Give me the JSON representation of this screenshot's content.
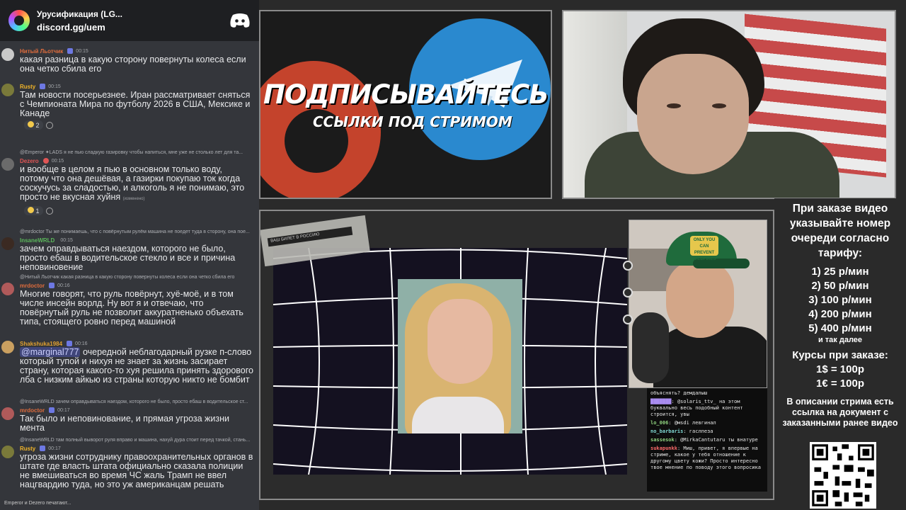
{
  "discord": {
    "server_name": "Урусификация (LG...",
    "invite": "discord.gg/uem",
    "messages": [
      {
        "reply": "",
        "author": "Нитый Льотчик",
        "author_color": "#e06c3c",
        "time": "00:15",
        "text": "какая разница в  какую сторону повернуты колеса если она четко сбила его",
        "mention": "",
        "edited": ""
      },
      {
        "reply": "",
        "author": "Rusty",
        "author_color": "#f0b429",
        "time": "00:15",
        "text": "Там новости посерьезнее. Иран рассматривает сняться с Чемпионата Мира по футболу 2026 в США, Мексике и Канаде",
        "mention": "",
        "edited": "",
        "reaction_count": "2"
      },
      {
        "reply": "@Emperor ✦LADS я не пью сладкую газировку чтобы напиться, мне уже не столько лет для та...",
        "author": "Dezero",
        "author_color": "#e05555",
        "time": "00:15",
        "text": "и вообще в целом я пью в основном только воду, потому что она дешёвая, а газирки покупаю ток когда соскучусь за сладостью, и алкоголь я не понимаю, это просто не вкусная хуйня",
        "mention": "",
        "edited": "(изменено)",
        "reaction_count": "1"
      },
      {
        "reply": "@mrdoctor Ты же понимаешь, что с повёрнутым рулём машина не поедет туда в сторону, она пое...",
        "author": "InsaneWRLD",
        "author_color": "#5bb85b",
        "time": "00:15",
        "text": "зачем оправдываться наездом, которого не было, просто ебаш в водительское стекло и все и причина неповиновение",
        "mention": "",
        "edited": ""
      },
      {
        "reply": "@Нитый Льотчик какая разница в  какую сторону повернуты колеса если она четко сбила его",
        "author": "mrdoctor",
        "author_color": "#e06c3c",
        "time": "00:16",
        "text": "Многие говорят, что руль повёрнут, хуё-моё, и в том числе инсейн ворлд. Ну вот я и отвечаю, что повёрнутый руль не позволит аккуратненько объехать типа, стоящего ровно перед машиной",
        "mention": "",
        "edited": ""
      },
      {
        "reply": "",
        "author": "Shakshuka1984",
        "author_color": "#e0a030",
        "time": "00:16",
        "text": " очередной неблагодарный рузке п-слово который тупой и нихуя не знает за жизнь засирает страну, которая какого-то хуя решила принять здорового лба с низким айкью из страны которую никто не бомбит",
        "mention": "@marginal777",
        "edited": ""
      },
      {
        "reply": "@InsaneWRLD зачем оправдываться наездом, которого не было, просто ебаш в водительское ст...",
        "author": "mrdoctor",
        "author_color": "#e06c3c",
        "time": "00:17",
        "text": "Так было и неповинование, и прямая угроза жизни мента",
        "mention": "",
        "edited": ""
      },
      {
        "reply": "@InsaneWRLD там полный выворот руля вправо и машина, нахуй дура стоит перед тачкой, стань...",
        "author": "Rusty",
        "author_color": "#f0b429",
        "time": "00:17",
        "text": "угроза жизни сотруднику правоохранительных органов в штате где власть штата официально сказала полиции не вмешиваться во время ЧС жаль Трамп не ввел нацгвардию туда, но это уж американцам решать",
        "mention": "",
        "edited": ""
      }
    ],
    "typing": "Emperor и Dezero печатают..."
  },
  "banner": {
    "title": "ПОДПИСЫВАЙТЕСЬ",
    "subtitle": "ССЫЛКИ ПОД СТРИМОМ",
    "colors": {
      "patreon": "#c4432c",
      "telegram": "#2a89cf"
    }
  },
  "scene": {
    "tape_text": "ВАШ БИЛЕТ В РОССИЮ",
    "hat_patch": "ONLY YOU CAN PREVENT WILDFIRES",
    "chat": [
      {
        "user": "",
        "text": "объяснять? демдалыш",
        "color": "plain"
      },
      {
        "user": "███████",
        "text": "@solaris_ttv_ на этом буквально весь подобный контент строится, увы",
        "color": "purple"
      },
      {
        "user": "lo_006",
        "text": "@мsdi левгинал",
        "color": "green"
      },
      {
        "user": "no_barbaris",
        "text": "гаслпеза",
        "color": "plain"
      },
      {
        "user": "sassesok",
        "text": "@MirkaCantutaru ты внатуре",
        "color": "plain"
      },
      {
        "user": "sukapunkk",
        "text": "Миш, привет, я впервые на стриме, какое у тебя отношение к другому цвету кожи? Просто интересно твое мнение по поводу этого вопросика",
        "color": "red"
      }
    ]
  },
  "info": {
    "title": "При заказе видео указывайте номер очереди согласно тарифу:",
    "tariffs": [
      "1) 25 р/мин",
      "2) 50 р/мин",
      "3) 100 р/мин",
      "4) 200 р/мин",
      "5) 400 р/мин"
    ],
    "etc": "и так далее",
    "courses_title": "Курсы при заказе:",
    "courses": [
      "1$ = 100р",
      "1€ = 100р"
    ],
    "description": "В описании стрима есть ссылка на документ с заказанными ранее видео"
  }
}
